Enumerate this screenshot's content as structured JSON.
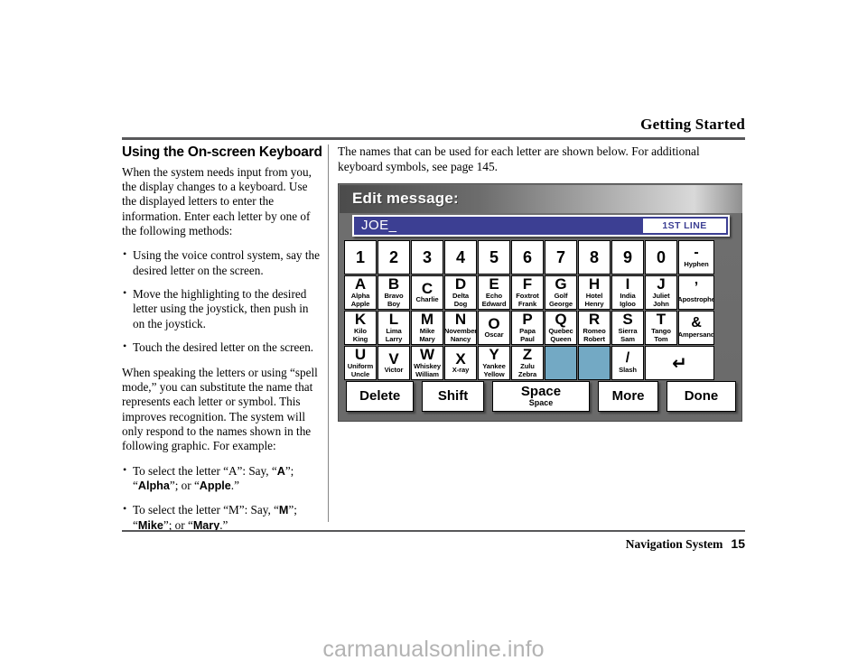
{
  "header": {
    "title": "Getting Started"
  },
  "footer": {
    "label": "Navigation System",
    "page": "15"
  },
  "watermark": {
    "text": "carmanualsonline.info"
  },
  "left_column": {
    "section_title": "Using the On-screen Keyboard",
    "paragraph1": "When the system needs input from you, the display changes to a keyboard. Use the displayed letters to enter the information. Enter each letter by one of the following methods:",
    "bullets1": [
      "Using the voice control system, say the desired letter on the screen.",
      "Move the highlighting to the desired letter using the joystick, then push in on the joystick.",
      "Touch the desired letter on the screen."
    ],
    "paragraph2": "When speaking the letters or using “spell mode,” you can substitute the name that represents each letter or symbol. This improves recognition. The system will only respond to the names shown in the following graphic. For example:",
    "bullet_a": {
      "pre": "To select the letter “A”: Say, “",
      "b1": "A",
      "mid1": "”; “",
      "b2": "Alpha",
      "mid2": "”; or “",
      "b3": "Apple",
      "post": ".”"
    },
    "bullet_m": {
      "pre": "To select the letter “M”: Say, “",
      "b1": "M",
      "mid1": "”; “",
      "b2": "Mike",
      "mid2": "”; or “",
      "b3": "Mary",
      "post": ".”"
    }
  },
  "right_column": {
    "intro": "The names that can be used for each letter are shown below. For additional keyboard symbols, see page 145."
  },
  "nav_screen": {
    "title": "Edit message:",
    "input_value": "JOE_",
    "line_badge": "1ST LINE",
    "colors": {
      "input_blue": "#3c3f93",
      "blank_key_blue": "#73a9c4",
      "bezel_gray": "#6f6f6f"
    },
    "rows": [
      [
        {
          "glyph": "1",
          "sub": "",
          "type": "num"
        },
        {
          "glyph": "2",
          "sub": "",
          "type": "num"
        },
        {
          "glyph": "3",
          "sub": "",
          "type": "num"
        },
        {
          "glyph": "4",
          "sub": "",
          "type": "num"
        },
        {
          "glyph": "5",
          "sub": "",
          "type": "num"
        },
        {
          "glyph": "6",
          "sub": "",
          "type": "num"
        },
        {
          "glyph": "7",
          "sub": "",
          "type": "num"
        },
        {
          "glyph": "8",
          "sub": "",
          "type": "num"
        },
        {
          "glyph": "9",
          "sub": "",
          "type": "num"
        },
        {
          "glyph": "0",
          "sub": "",
          "type": "num"
        },
        {
          "glyph": "-",
          "sub": "Hyphen",
          "type": "sym",
          "wide": true
        }
      ],
      [
        {
          "glyph": "A",
          "sub": "Alpha\nApple"
        },
        {
          "glyph": "B",
          "sub": "Bravo\nBoy"
        },
        {
          "glyph": "C",
          "sub": "Charlie"
        },
        {
          "glyph": "D",
          "sub": "Delta\nDog"
        },
        {
          "glyph": "E",
          "sub": "Echo\nEdward"
        },
        {
          "glyph": "F",
          "sub": "Foxtrot\nFrank"
        },
        {
          "glyph": "G",
          "sub": "Golf\nGeorge"
        },
        {
          "glyph": "H",
          "sub": "Hotel\nHenry"
        },
        {
          "glyph": "I",
          "sub": "India\nIgloo"
        },
        {
          "glyph": "J",
          "sub": "Juliet\nJohn"
        },
        {
          "glyph": "’",
          "sub": "Apostrophe",
          "type": "sym",
          "wide": true
        }
      ],
      [
        {
          "glyph": "K",
          "sub": "Kilo\nKing"
        },
        {
          "glyph": "L",
          "sub": "Lima\nLarry"
        },
        {
          "glyph": "M",
          "sub": "Mike\nMary"
        },
        {
          "glyph": "N",
          "sub": "November\nNancy"
        },
        {
          "glyph": "O",
          "sub": "Oscar"
        },
        {
          "glyph": "P",
          "sub": "Papa\nPaul"
        },
        {
          "glyph": "Q",
          "sub": "Quebec\nQueen"
        },
        {
          "glyph": "R",
          "sub": "Romeo\nRobert"
        },
        {
          "glyph": "S",
          "sub": "Sierra\nSam"
        },
        {
          "glyph": "T",
          "sub": "Tango\nTom"
        },
        {
          "glyph": "&",
          "sub": "Ampersand",
          "type": "sym",
          "wide": true
        }
      ],
      [
        {
          "glyph": "U",
          "sub": "Uniform\nUncle"
        },
        {
          "glyph": "V",
          "sub": "Victor"
        },
        {
          "glyph": "W",
          "sub": "Whiskey\nWilliam"
        },
        {
          "glyph": "X",
          "sub": "X-ray"
        },
        {
          "glyph": "Y",
          "sub": "Yankee\nYellow"
        },
        {
          "glyph": "Z",
          "sub": "Zulu\nZebra"
        },
        {
          "glyph": "",
          "sub": "",
          "type": "blank"
        },
        {
          "glyph": "",
          "sub": "",
          "type": "blank"
        },
        {
          "glyph": "/",
          "sub": "Slash",
          "type": "sym"
        },
        {
          "glyph": "⮐",
          "sub": "",
          "type": "enter",
          "span": 2
        }
      ]
    ],
    "function_buttons": [
      {
        "label": "Delete",
        "sub": ""
      },
      {
        "label": "Shift",
        "sub": ""
      },
      {
        "label": "Space",
        "sub": "Space"
      },
      {
        "label": "More",
        "sub": ""
      },
      {
        "label": "Done",
        "sub": ""
      }
    ]
  }
}
